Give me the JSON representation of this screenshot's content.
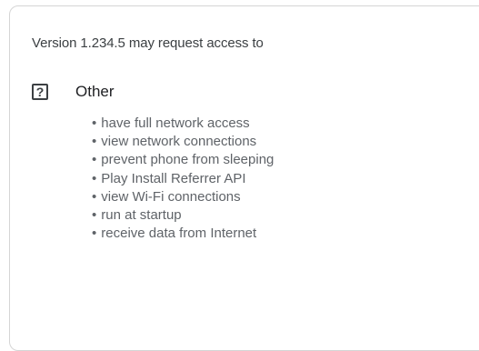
{
  "dialog": {
    "header": "Version 1.234.5  may request access to",
    "group": {
      "icon": "question-mark-icon",
      "icon_glyph": "?",
      "title": "Other",
      "bullet": "•",
      "permissions": [
        "have full network access",
        "view network connections",
        "prevent phone from sleeping",
        "Play Install Referrer API",
        "view Wi-Fi connections",
        "run at startup",
        "receive data from Internet"
      ]
    }
  }
}
